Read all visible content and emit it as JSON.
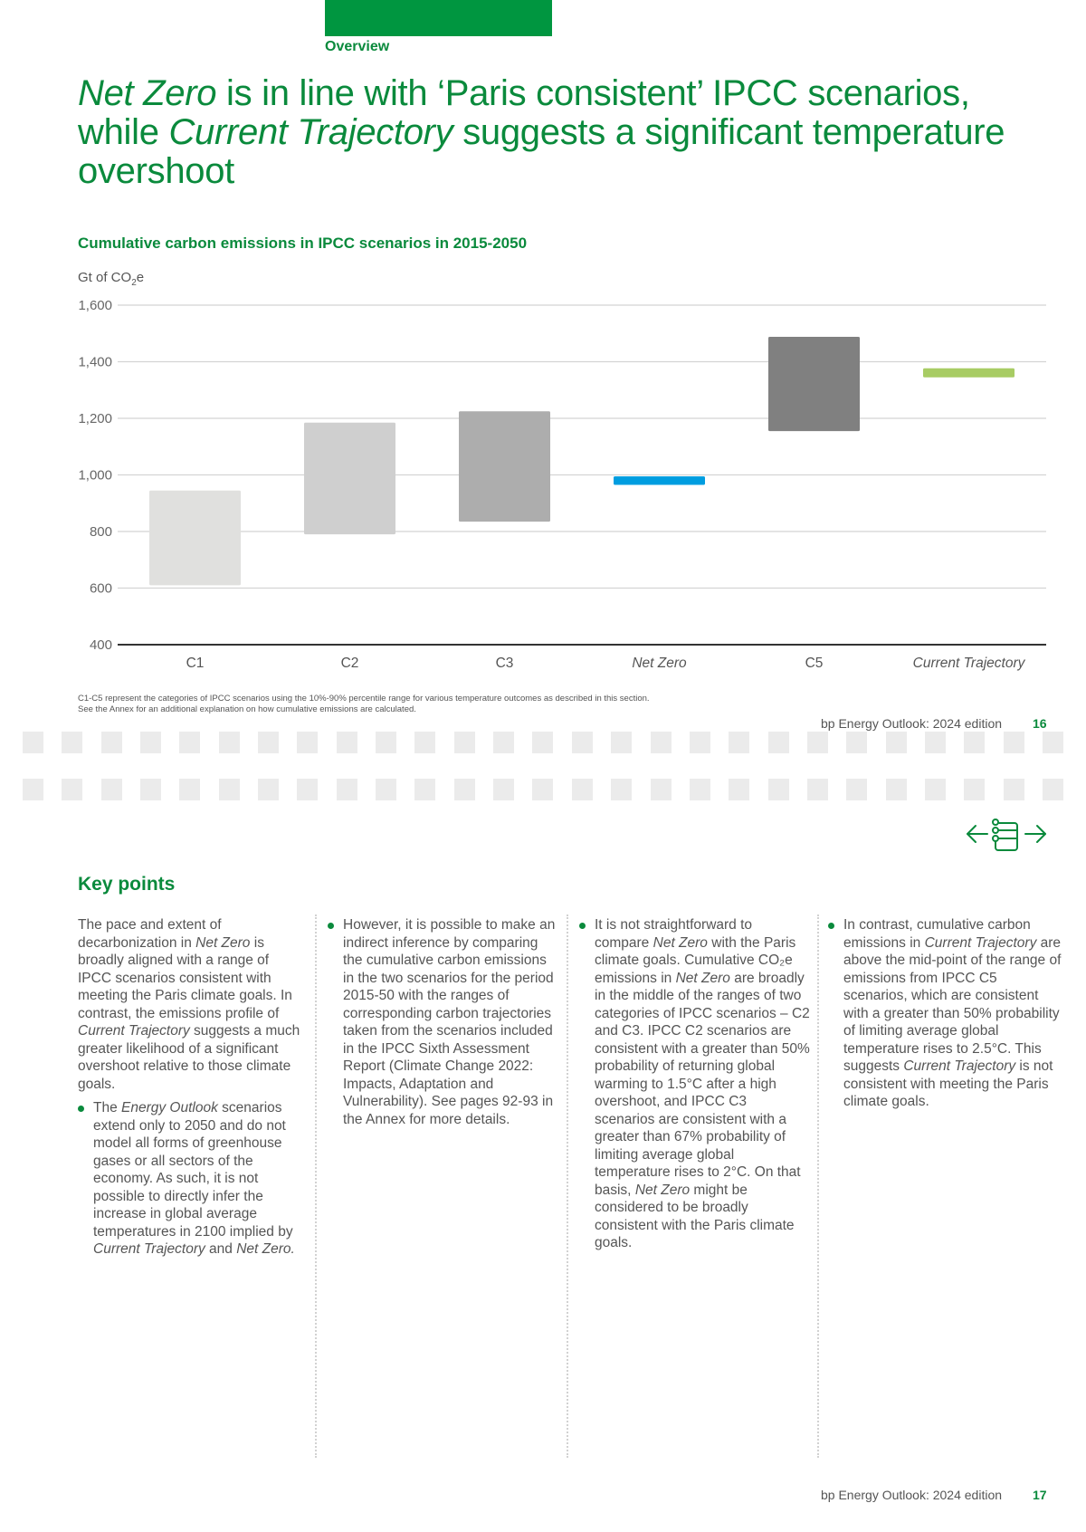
{
  "header": {
    "section_label": "Overview",
    "headline": {
      "part1_italic": "Net Zero",
      "part2": " is in line with ‘Paris consistent’ IPCC scenarios, while ",
      "part3_italic": "Current Trajectory",
      "part4": " suggests a significant temperature overshoot"
    },
    "accent_color": "#009640"
  },
  "chart_data": {
    "type": "bar",
    "subtype": "floating-range",
    "title": "Cumulative carbon emissions in IPCC scenarios in 2015-2050",
    "ylabel": "Gt of CO₂e",
    "ylabel_main": "Gt of CO",
    "ylabel_sub": "2",
    "ylabel_tail": "e",
    "xlabel": "",
    "ylim": [
      400,
      1600
    ],
    "yticks": [
      400,
      600,
      800,
      1000,
      1200,
      1400,
      1600
    ],
    "ytick_labels": [
      "400",
      "600",
      "800",
      "1,000",
      "1,200",
      "1,400",
      "1,600"
    ],
    "grid": true,
    "legend": "none",
    "categories": [
      "C1",
      "C2",
      "C3",
      "Net Zero",
      "C5",
      "Current Trajectory"
    ],
    "category_italic": [
      false,
      false,
      false,
      true,
      false,
      true
    ],
    "ranges": [
      {
        "low": 610,
        "high": 945,
        "color": "#e0e0de"
      },
      {
        "low": 790,
        "high": 1185,
        "color": "#cfcfcf"
      },
      {
        "low": 835,
        "high": 1225,
        "color": "#adadad"
      },
      {
        "low": 965,
        "high": 995,
        "color": "#009de0"
      },
      {
        "low": 1155,
        "high": 1488,
        "color": "#808080"
      },
      {
        "low": 1345,
        "high": 1377,
        "color": "#a8cc64"
      }
    ]
  },
  "footnote": {
    "line1": "C1-C5 represent the categories of IPCC scenarios using the 10%-90% percentile range for various temperature outcomes as described in this section.",
    "line2": "See the Annex for an additional explanation on how cumulative emissions are calculated."
  },
  "footer_top": {
    "publication": "bp Energy Outlook: 2024 edition",
    "page": "16"
  },
  "footer_bottom": {
    "publication": "bp Energy Outlook: 2024 edition",
    "page": "17"
  },
  "nav": {
    "prev_icon": "arrow-left-icon",
    "contents_icon": "contents-list-icon",
    "next_icon": "arrow-right-icon"
  },
  "key_points": {
    "title": "Key points",
    "col1": {
      "intro": [
        {
          "t": "The pace and extent of decarbonization in "
        },
        {
          "t": "Net Zero",
          "i": true
        },
        {
          "t": " is broadly aligned with a range of IPCC scenarios consistent with meeting the Paris climate goals. In contrast, the emissions profile of "
        },
        {
          "t": "Current Trajectory",
          "i": true
        },
        {
          "t": " suggests a much greater likelihood of a significant overshoot relative to those climate goals."
        }
      ],
      "bullet": [
        {
          "t": "The "
        },
        {
          "t": "Energy Outlook",
          "i": true
        },
        {
          "t": " scenarios extend only to 2050 and do not model all forms of greenhouse gases or all sectors of the economy. As such, it is not possible to directly infer the increase in global average temperatures in 2100 implied by "
        },
        {
          "t": "Current Trajectory",
          "i": true
        },
        {
          "t": " and "
        },
        {
          "t": "Net Zero.",
          "i": true
        }
      ]
    },
    "col2": {
      "bullet": [
        {
          "t": "However, it is possible to make an indirect inference by comparing the cumulative carbon emissions in the two scenarios for the period 2015-50 with the ranges of corresponding carbon trajectories taken from the scenarios included in the IPCC Sixth Assessment Report (Climate Change 2022: Impacts, Adaptation and Vulnerability). See pages 92-93 in the Annex for more details."
        }
      ]
    },
    "col3": {
      "bullet": [
        {
          "t": "It is not straightforward to compare "
        },
        {
          "t": "Net Zero",
          "i": true
        },
        {
          "t": " with the Paris climate goals. Cumulative CO₂e emissions in "
        },
        {
          "t": "Net Zero",
          "i": true
        },
        {
          "t": " are broadly in the middle of the ranges of two categories of IPCC scenarios – C2 and C3. IPCC C2 scenarios are consistent with a greater than 50% probability of returning global warming to 1.5°C after a high overshoot, and IPCC C3 scenarios are consistent with a greater than 67% probability of limiting average global temperature rises to 2°C. On that basis, "
        },
        {
          "t": "Net Zero",
          "i": true
        },
        {
          "t": " might be considered to be broadly consistent with the Paris climate goals."
        }
      ]
    },
    "col4": {
      "bullet": [
        {
          "t": "In contrast, cumulative carbon emissions in "
        },
        {
          "t": "Current Trajectory",
          "i": true
        },
        {
          "t": " are above the mid-point of the range of emissions from IPCC C5 scenarios, which are consistent with a greater than 50% probability of limiting average global temperature rises to 2.5°C. This suggests "
        },
        {
          "t": "Current Trajectory",
          "i": true
        },
        {
          "t": " is not consistent with meeting the Paris climate goals."
        }
      ]
    }
  }
}
